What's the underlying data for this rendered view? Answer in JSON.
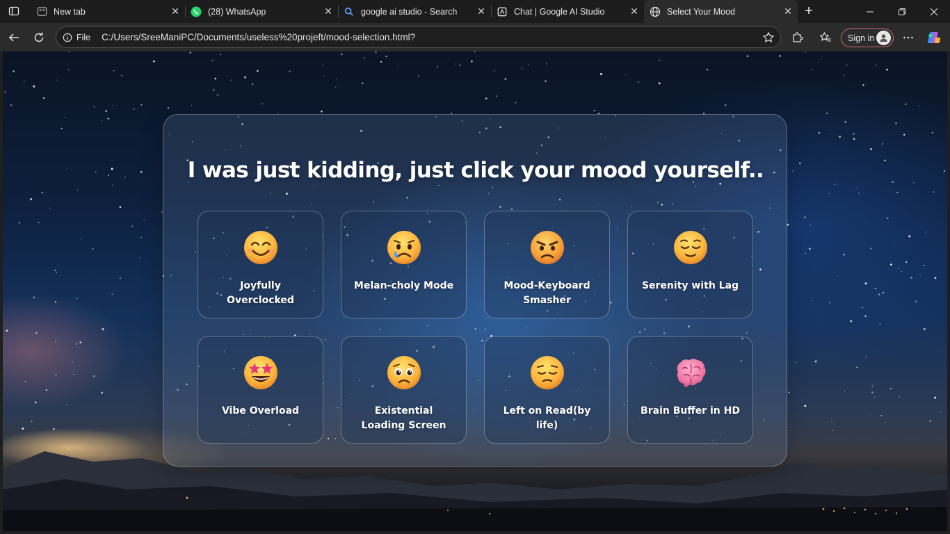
{
  "browser": {
    "tabs": [
      {
        "title": "New tab",
        "icon": "newtab-icon"
      },
      {
        "title": "(28) WhatsApp",
        "icon": "whatsapp-icon"
      },
      {
        "title": "google ai studio - Search",
        "icon": "search-icon"
      },
      {
        "title": "Chat | Google AI Studio",
        "icon": "ai-studio-icon"
      },
      {
        "title": "Select Your Mood",
        "icon": "globe-icon",
        "active": true
      }
    ],
    "address": {
      "scheme_label": "File",
      "url": "C:/Users/SreeManiPC/Documents/useless%20projeft/mood-selection.html?"
    },
    "signin_label": "Sign in"
  },
  "page": {
    "heading": "I was just kidding, just click your mood yourself..",
    "moods": [
      {
        "label": "Joyfully Overclocked",
        "icon": "smiling-face-icon"
      },
      {
        "label": "Melan-choly Mode",
        "icon": "crying-face-icon"
      },
      {
        "label": "Mood-Keyboard Smasher",
        "icon": "angry-face-icon"
      },
      {
        "label": "Serenity with Lag",
        "icon": "relieved-face-icon"
      },
      {
        "label": "Vibe Overload",
        "icon": "star-struck-face-icon"
      },
      {
        "label": "Existential Loading Screen",
        "icon": "pleading-face-icon"
      },
      {
        "label": "Left on Read(by life)",
        "icon": "pensive-face-icon"
      },
      {
        "label": "Brain Buffer in HD",
        "icon": "brain-icon"
      }
    ]
  },
  "colors": {
    "accent_signin_border": "#d06a6a",
    "emoji_yellow": "#f7b53a",
    "brain_pink": "#f07aa5"
  }
}
